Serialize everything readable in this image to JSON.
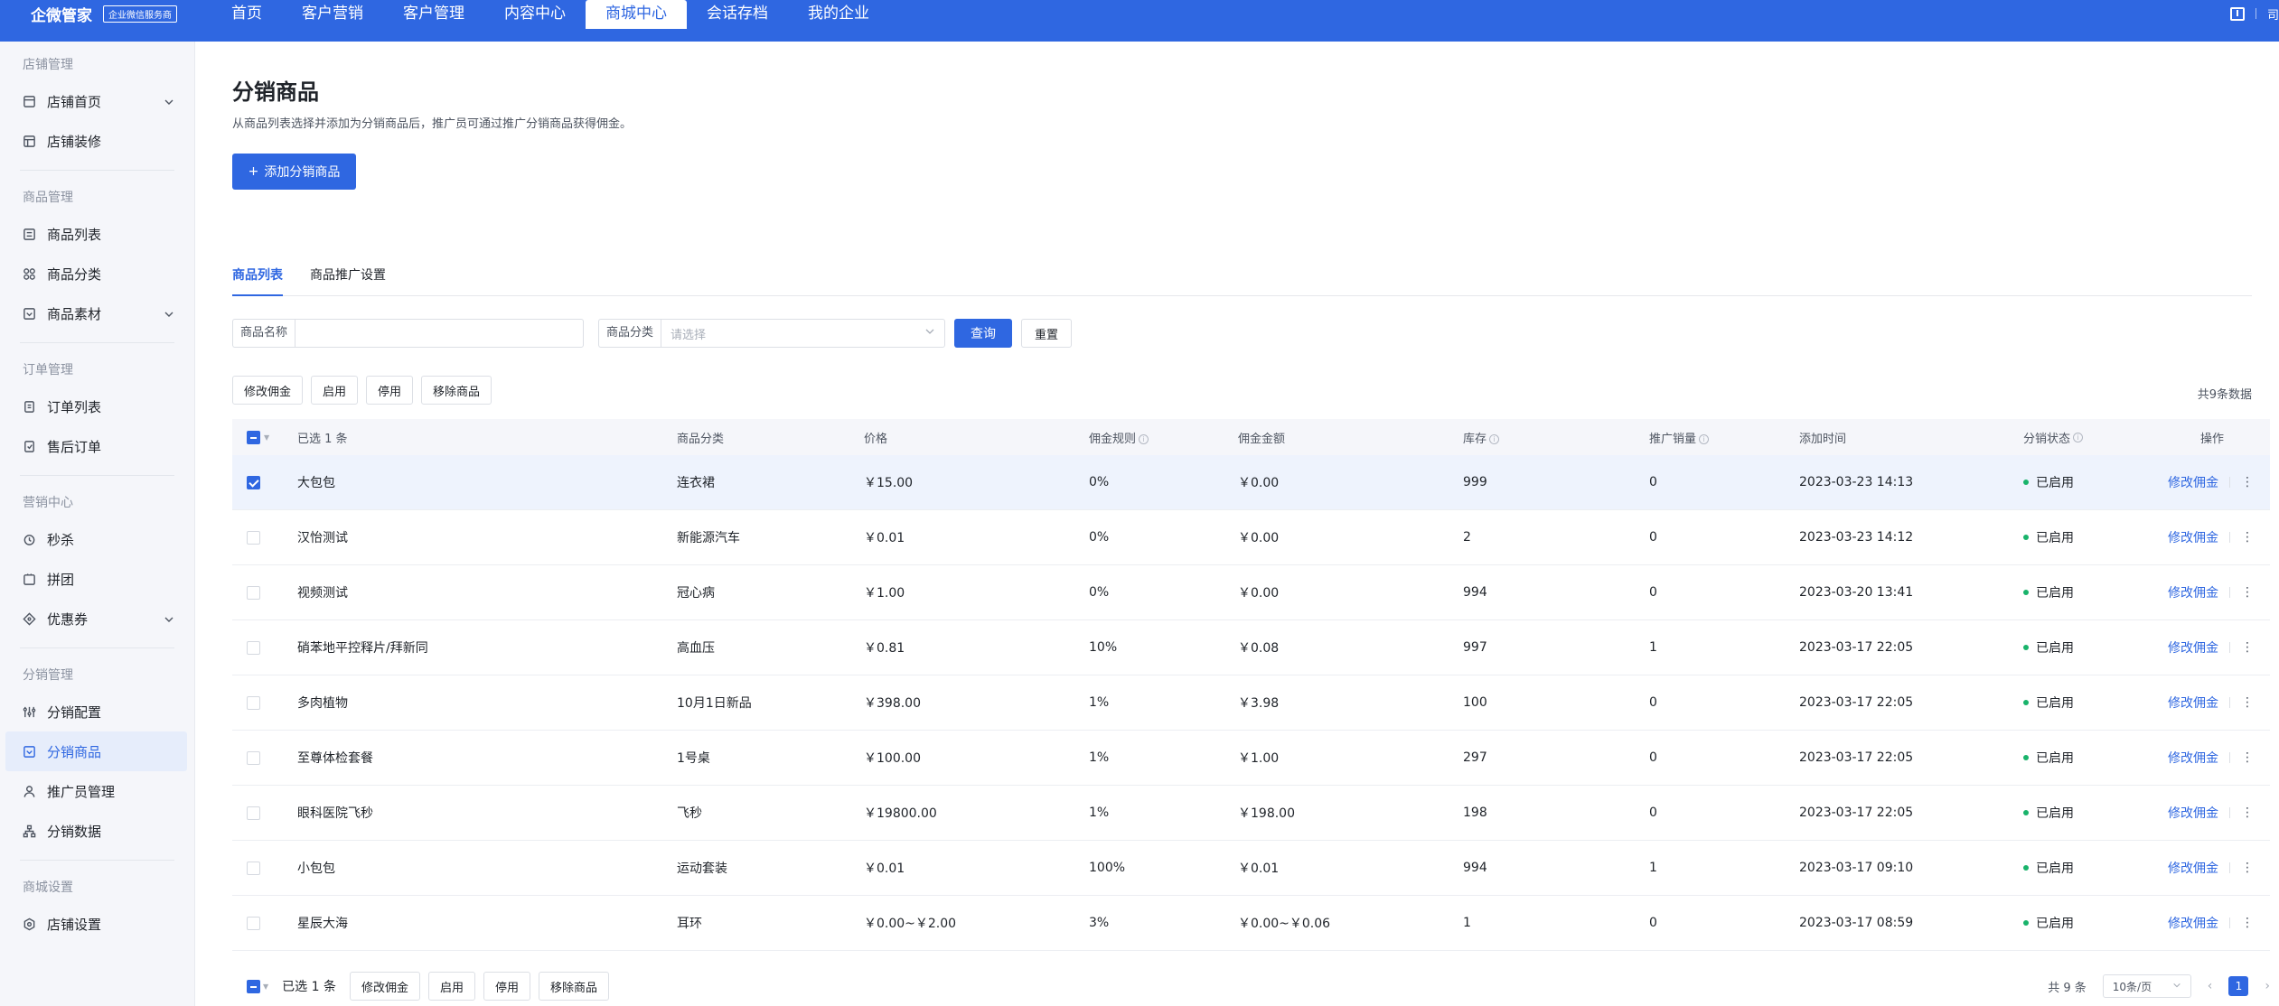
{
  "topbar": {
    "brand": "企微管家",
    "badge": "企业微信服务商",
    "nav": [
      "首页",
      "客户营销",
      "客户管理",
      "内容中心",
      "商城中心",
      "会话存档",
      "我的企业"
    ],
    "user": "司"
  },
  "sidebar": {
    "groups": [
      {
        "title": "店铺管理",
        "items": [
          "店铺首页",
          "店铺装修"
        ]
      },
      {
        "title": "商品管理",
        "items": [
          "商品列表",
          "商品分类",
          "商品素材"
        ]
      },
      {
        "title": "订单管理",
        "items": [
          "订单列表",
          "售后订单"
        ]
      },
      {
        "title": "营销中心",
        "items": [
          "秒杀",
          "拼团",
          "优惠券"
        ]
      },
      {
        "title": "分销管理",
        "items": [
          "分销配置",
          "分销商品",
          "推广员管理",
          "分销数据"
        ]
      },
      {
        "title": "商城设置",
        "items": [
          "店铺设置"
        ]
      }
    ]
  },
  "page": {
    "title": "分销商品",
    "desc": "从商品列表选择并添加为分销商品后，推广员可通过推广分销商品获得佣金。",
    "add_button": "添加分销商品",
    "tabs": [
      "商品列表",
      "商品推广设置"
    ]
  },
  "filters": {
    "name_label": "商品名称",
    "name_value": "",
    "category_label": "商品分类",
    "category_placeholder": "请选择",
    "query": "查询",
    "reset": "重置"
  },
  "actions": {
    "edit_commission": "修改佣金",
    "enable": "启用",
    "disable": "停用",
    "remove": "移除商品",
    "total": "共9条数据"
  },
  "table": {
    "headers": {
      "selected": "已选 1 条",
      "category": "商品分类",
      "price": "价格",
      "rule": "佣金规则",
      "amount": "佣金金额",
      "stock": "库存",
      "sales": "推广销量",
      "time": "添加时间",
      "status": "分销状态",
      "op": "操作"
    },
    "rows": [
      {
        "name": "大包包",
        "category": "连衣裙",
        "price": "￥15.00",
        "rule": "0%",
        "amount": "￥0.00",
        "stock": "999",
        "sales": "0",
        "time": "2023-03-23 14:13",
        "status": "已启用",
        "op": "修改佣金"
      },
      {
        "name": "汉怡测试",
        "category": "新能源汽车",
        "price": "￥0.01",
        "rule": "0%",
        "amount": "￥0.00",
        "stock": "2",
        "sales": "0",
        "time": "2023-03-23 14:12",
        "status": "已启用",
        "op": "修改佣金"
      },
      {
        "name": "视频测试",
        "category": "冠心病",
        "price": "￥1.00",
        "rule": "0%",
        "amount": "￥0.00",
        "stock": "994",
        "sales": "0",
        "time": "2023-03-20 13:41",
        "status": "已启用",
        "op": "修改佣金"
      },
      {
        "name": "硝苯地平控释片/拜新同",
        "category": "高血压",
        "price": "￥0.81",
        "rule": "10%",
        "amount": "￥0.08",
        "stock": "997",
        "sales": "1",
        "time": "2023-03-17 22:05",
        "status": "已启用",
        "op": "修改佣金"
      },
      {
        "name": "多肉植物",
        "category": "10月1日新品",
        "price": "￥398.00",
        "rule": "1%",
        "amount": "￥3.98",
        "stock": "100",
        "sales": "0",
        "time": "2023-03-17 22:05",
        "status": "已启用",
        "op": "修改佣金"
      },
      {
        "name": "至尊体检套餐",
        "category": "1号桌",
        "price": "￥100.00",
        "rule": "1%",
        "amount": "￥1.00",
        "stock": "297",
        "sales": "0",
        "time": "2023-03-17 22:05",
        "status": "已启用",
        "op": "修改佣金"
      },
      {
        "name": "眼科医院飞秒",
        "category": "飞秒",
        "price": "￥19800.00",
        "rule": "1%",
        "amount": "￥198.00",
        "stock": "198",
        "sales": "0",
        "time": "2023-03-17 22:05",
        "status": "已启用",
        "op": "修改佣金"
      },
      {
        "name": "小包包",
        "category": "运动套装",
        "price": "￥0.01",
        "rule": "100%",
        "amount": "￥0.01",
        "stock": "994",
        "sales": "1",
        "time": "2023-03-17 09:10",
        "status": "已启用",
        "op": "修改佣金"
      },
      {
        "name": "星辰大海",
        "category": "耳环",
        "price": "￥0.00~￥2.00",
        "rule": "3%",
        "amount": "￥0.00~￥0.06",
        "stock": "1",
        "sales": "0",
        "time": "2023-03-17 08:59",
        "status": "已启用",
        "op": "修改佣金"
      }
    ]
  },
  "footer": {
    "selected": "已选 1 条",
    "total": "共 9 条",
    "page_size": "10条/页",
    "page": "1"
  },
  "colors": {
    "primary": "#2f67e1",
    "success": "#19b36b",
    "sidebar_bg": "#f5f6fa"
  }
}
